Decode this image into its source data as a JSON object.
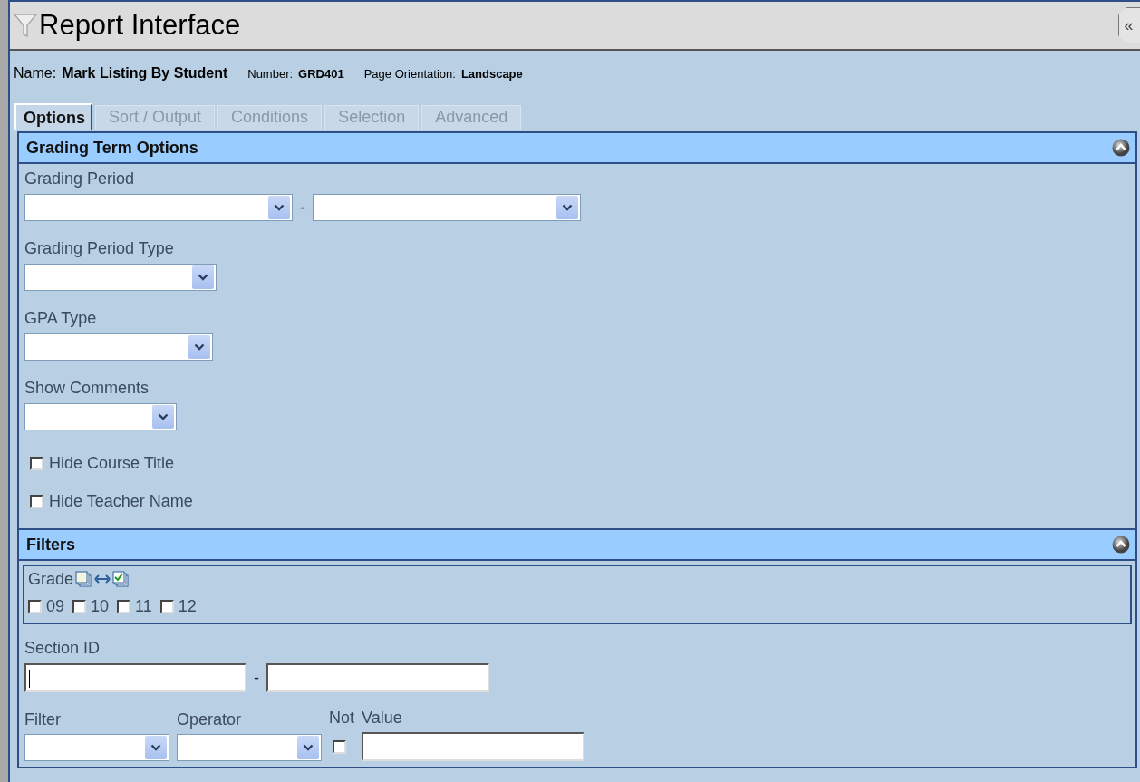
{
  "window": {
    "title": "Report Interface",
    "collapse_button": "«"
  },
  "report": {
    "name_label": "Name:",
    "name": "Mark Listing By Student",
    "number_label": "Number:",
    "number": "GRD401",
    "orientation_label": "Page Orientation:",
    "orientation": "Landscape"
  },
  "tabs": [
    {
      "label": "Options",
      "selected": true
    },
    {
      "label": "Sort / Output",
      "selected": false
    },
    {
      "label": "Conditions",
      "selected": false
    },
    {
      "label": "Selection",
      "selected": false
    },
    {
      "label": "Advanced",
      "selected": false
    }
  ],
  "sections": [
    {
      "title": "Grading Term Options",
      "expanded": true,
      "fields": [
        {
          "kind": "select-range",
          "label": "Grading Period",
          "separator": "-"
        },
        {
          "kind": "select",
          "label": "Grading Period Type"
        },
        {
          "kind": "select",
          "label": "GPA Type"
        },
        {
          "kind": "select",
          "label": "Show Comments"
        },
        {
          "kind": "checkbox",
          "label": "Hide Course Title",
          "checked": false
        },
        {
          "kind": "checkbox",
          "label": "Hide Teacher Name",
          "checked": false
        }
      ]
    },
    {
      "title": "Filters",
      "expanded": true,
      "fields": [
        {
          "kind": "grade-group",
          "label": "Grade",
          "options": [
            {
              "label": "09",
              "checked": false
            },
            {
              "label": "10",
              "checked": false
            },
            {
              "label": "11",
              "checked": false
            },
            {
              "label": "12",
              "checked": false
            }
          ]
        },
        {
          "kind": "text-range",
          "label": "Section ID",
          "separator": "-"
        },
        {
          "kind": "filter-row",
          "filter_label": "Filter",
          "operator_label": "Operator",
          "not_label": "Not",
          "not_checked": false,
          "value_label": "Value"
        }
      ]
    }
  ]
}
